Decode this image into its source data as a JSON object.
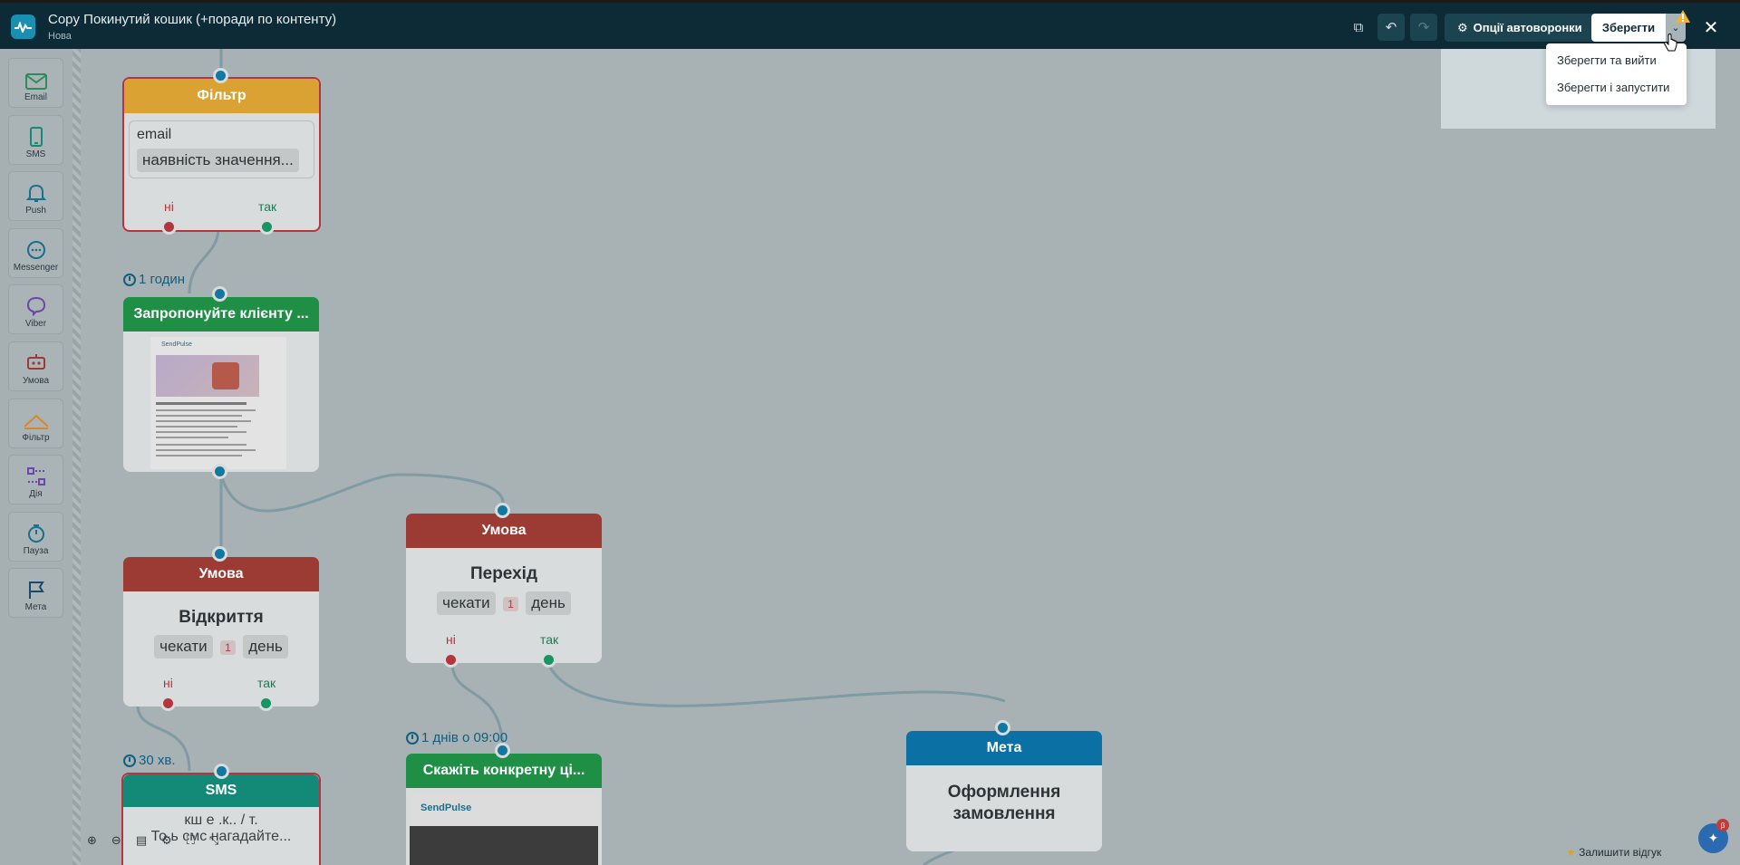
{
  "app": {
    "title": "Copy Покинутий кошик (+поради по контенту)",
    "subtitle": "Нова"
  },
  "toolbar": {
    "options_label": "Опції автоворонки",
    "save_label": "Зберегти",
    "save_caret": "⌄"
  },
  "save_menu": {
    "items": [
      "Зберегти та вийти",
      "Зберегти і запустити"
    ]
  },
  "palette": {
    "items": [
      {
        "label": "Email",
        "icon": "email-icon"
      },
      {
        "label": "SMS",
        "icon": "sms-icon"
      },
      {
        "label": "Push",
        "icon": "push-icon"
      },
      {
        "label": "Messenger",
        "icon": "messenger-icon"
      },
      {
        "label": "Viber",
        "icon": "viber-icon"
      },
      {
        "label": "Умова",
        "icon": "condition-icon"
      },
      {
        "label": "Фільтр",
        "icon": "filter-icon"
      },
      {
        "label": "Дія",
        "icon": "action-icon"
      },
      {
        "label": "Пауза",
        "icon": "pause-icon"
      },
      {
        "label": "Мета",
        "icon": "goal-icon"
      }
    ]
  },
  "nodes": {
    "filter": {
      "header": "Фільтр",
      "field": "email",
      "rule": "наявність значення...",
      "no": "ні",
      "yes": "так"
    },
    "delay1": "1 годин",
    "email1": {
      "header": "Запропонуйте клієнту ...",
      "brand": "SendPulse"
    },
    "cond1": {
      "header": "Умова",
      "title": "Відкриття",
      "wait": "чекати",
      "num": "1",
      "unit": "день",
      "no": "ні",
      "yes": "так"
    },
    "cond2": {
      "header": "Умова",
      "title": "Перехід",
      "wait": "чекати",
      "num": "1",
      "unit": "день",
      "no": "ні",
      "yes": "так"
    },
    "delay2": "30 хв.",
    "sms": {
      "header": "SMS",
      "text1": "кш е .к.. / т.",
      "text2": "То ь смс нагадайте..."
    },
    "delay3": "1 днів о 09:00",
    "email2": {
      "header": "Скажіть конкретну ці...",
      "brand": "SendPulse"
    },
    "goal": {
      "header": "Мета",
      "title": "Оформлення замовлення"
    }
  },
  "footer": {
    "feedback": "Залишити відгук",
    "chat_badge": "β"
  },
  "colors": {
    "topbar": "#0c2b36",
    "filter": "#d9a233",
    "condition": "#9b3b33",
    "email": "#1f8f46",
    "sms": "#138a77",
    "goal": "#0b70a3"
  }
}
